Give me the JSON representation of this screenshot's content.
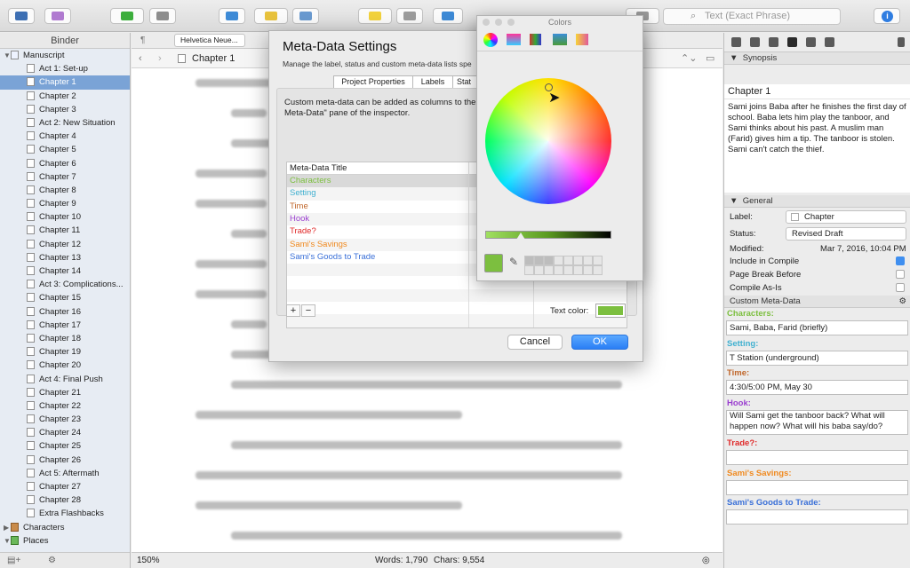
{
  "toolbar": {
    "search_placeholder": "Text (Exact Phrase)",
    "info_label": "i"
  },
  "binder": {
    "header": "Binder",
    "root": "Manuscript",
    "items": [
      {
        "label": "Act 1: Set-up",
        "selected": false
      },
      {
        "label": "Chapter 1",
        "selected": true
      },
      {
        "label": "Chapter 2",
        "selected": false
      },
      {
        "label": "Chapter 3",
        "selected": false
      },
      {
        "label": "Act 2: New Situation",
        "selected": false
      },
      {
        "label": "Chapter 4",
        "selected": false
      },
      {
        "label": "Chapter 5",
        "selected": false
      },
      {
        "label": "Chapter 6",
        "selected": false
      },
      {
        "label": "Chapter 7",
        "selected": false
      },
      {
        "label": "Chapter 8",
        "selected": false
      },
      {
        "label": "Chapter 9",
        "selected": false
      },
      {
        "label": "Chapter 10",
        "selected": false
      },
      {
        "label": "Chapter 11",
        "selected": false
      },
      {
        "label": "Chapter 12",
        "selected": false
      },
      {
        "label": "Chapter 13",
        "selected": false
      },
      {
        "label": "Chapter 14",
        "selected": false
      },
      {
        "label": "Act 3: Complications...",
        "selected": false
      },
      {
        "label": "Chapter 15",
        "selected": false
      },
      {
        "label": "Chapter 16",
        "selected": false
      },
      {
        "label": "Chapter 17",
        "selected": false
      },
      {
        "label": "Chapter 18",
        "selected": false
      },
      {
        "label": "Chapter 19",
        "selected": false
      },
      {
        "label": "Chapter 20",
        "selected": false
      },
      {
        "label": "Act 4: Final Push",
        "selected": false
      },
      {
        "label": "Chapter 21",
        "selected": false
      },
      {
        "label": "Chapter 22",
        "selected": false
      },
      {
        "label": "Chapter 23",
        "selected": false
      },
      {
        "label": "Chapter 24",
        "selected": false
      },
      {
        "label": "Chapter 25",
        "selected": false
      },
      {
        "label": "Chapter 26",
        "selected": false
      },
      {
        "label": "Act 5: Aftermath",
        "selected": false
      },
      {
        "label": "Chapter 27",
        "selected": false
      },
      {
        "label": "Chapter 28",
        "selected": false
      },
      {
        "label": "Extra Flashbacks",
        "selected": false
      }
    ],
    "folders": [
      "Characters",
      "Places"
    ]
  },
  "editor": {
    "font_name": "Helvetica Neue...",
    "doc_title": "Chapter 1",
    "zoom": "150%",
    "words": "Words: 1,790",
    "chars": "Chars: 9,554"
  },
  "dialog": {
    "title": "Meta-Data Settings",
    "subtitle": "Manage the label, status and custom meta-data lists spe",
    "tabs": [
      "Project Properties",
      "Labels",
      "Stat"
    ],
    "description": "Custom meta-data can be added as columns to the",
    "description_tail": "m",
    "description_line2": "Meta-Data\" pane of the inspector.",
    "column_header": "Meta-Data Title",
    "rows": [
      {
        "title": "Characters",
        "color": "#7cbf3f"
      },
      {
        "title": "Setting",
        "color": "#3fb0d0"
      },
      {
        "title": "Time",
        "color": "#c0662a"
      },
      {
        "title": "Hook",
        "color": "#9b3fd0"
      },
      {
        "title": "Trade?",
        "color": "#e02a2a"
      },
      {
        "title": "Sami's Savings",
        "color": "#f08a20"
      },
      {
        "title": "Sami's Goods to Trade",
        "color": "#3a70d8"
      }
    ],
    "plus": "+",
    "minus": "−",
    "text_color_label": "Text color:",
    "text_color": "#7cbf3f",
    "cancel": "Cancel",
    "ok": "OK"
  },
  "colors_panel": {
    "title": "Colors"
  },
  "inspector": {
    "synopsis_header": "Synopsis",
    "synopsis_title": "Chapter 1",
    "synopsis_text": "Sami joins Baba after he finishes the first day of school. Baba lets him play the tanboor, and Sami thinks about his past. A muslim man (Farid) gives him a tip. The tanboor is stolen. Sami can't catch the thief.",
    "general_header": "General",
    "label_label": "Label:",
    "label_value": "Chapter",
    "status_label": "Status:",
    "status_value": "Revised Draft",
    "modified_label": "Modified:",
    "modified_value": "Mar 7, 2016, 10:04 PM",
    "include_compile": "Include in Compile",
    "page_break": "Page Break Before",
    "compile_as_is": "Compile As-Is",
    "custom_header": "Custom Meta-Data",
    "fields": [
      {
        "label": "Characters:",
        "value": "Sami, Baba, Farid (briefly)",
        "color": "#7cbf3f"
      },
      {
        "label": "Setting:",
        "value": "T Station (underground)",
        "color": "#3fb0d0"
      },
      {
        "label": "Time:",
        "value": "4:30/5:00 PM, May 30",
        "color": "#c0662a"
      },
      {
        "label": "Hook:",
        "value": "Will Sami get the tanboor back? What will happen now? What will his baba say/do?",
        "color": "#9b3fd0"
      },
      {
        "label": "Trade?:",
        "value": "",
        "color": "#e02a2a"
      },
      {
        "label": "Sami's Savings:",
        "value": "",
        "color": "#f08a20"
      },
      {
        "label": "Sami's Goods to Trade:",
        "value": "",
        "color": "#3a70d8"
      }
    ]
  }
}
